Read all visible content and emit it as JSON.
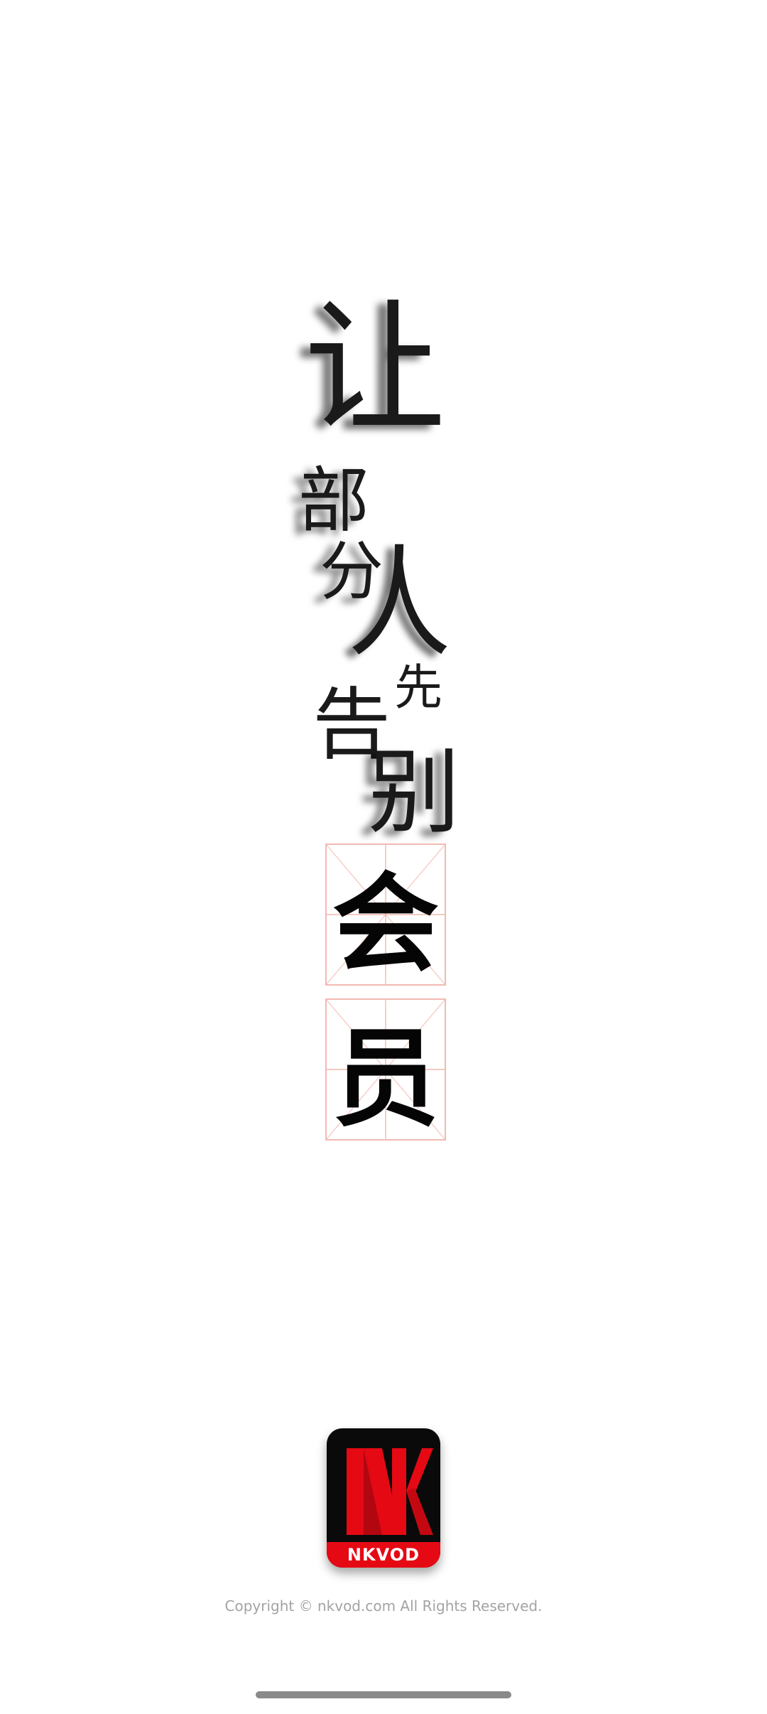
{
  "slogan": {
    "chars": [
      "让",
      "部",
      "分",
      "人",
      "先",
      "告",
      "别"
    ],
    "highlight": [
      "会",
      "员"
    ]
  },
  "logo": {
    "mark": "NK",
    "label": "NKVOD",
    "colors": {
      "background": "#0a0a0a",
      "accent": "#e50914"
    }
  },
  "footer": {
    "copyright": "Copyright © nkvod.com  All Rights Reserved."
  }
}
